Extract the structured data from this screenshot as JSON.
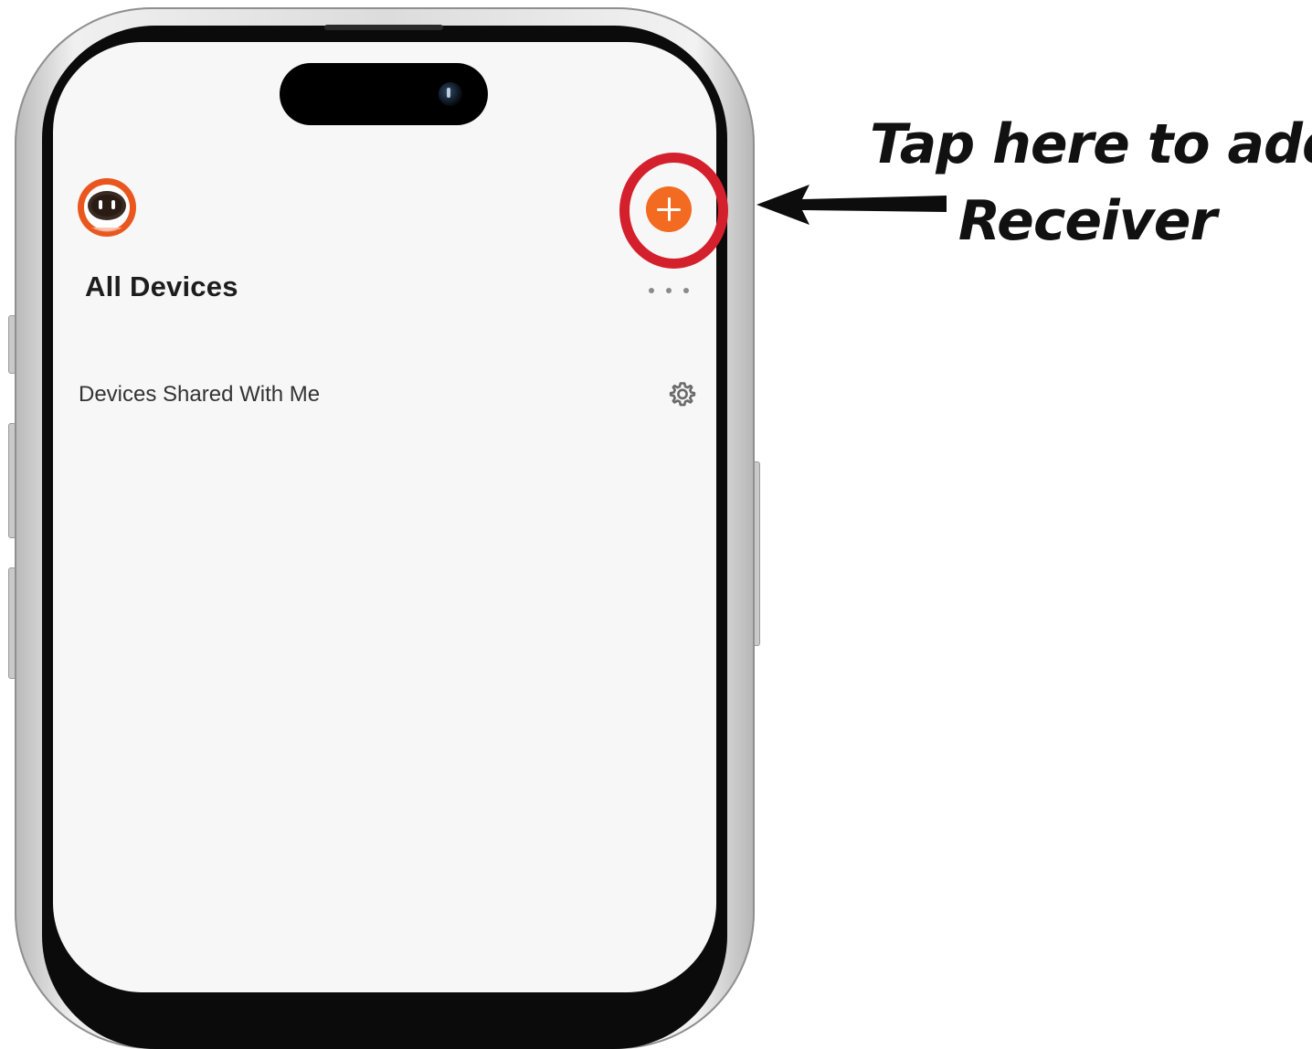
{
  "screen": {
    "page_title": "All Devices",
    "section_label": "Devices Shared With Me",
    "add_button_color": "#f36a21",
    "avatar_icon": "robot-logo-icon",
    "more_icon": "more-horizontal-icon",
    "settings_icon": "gear-icon"
  },
  "annotation": {
    "line1": "Tap here to add",
    "line2": "Receiver",
    "ring_color": "#d4202c",
    "arrow_icon": "arrow-left-icon"
  }
}
